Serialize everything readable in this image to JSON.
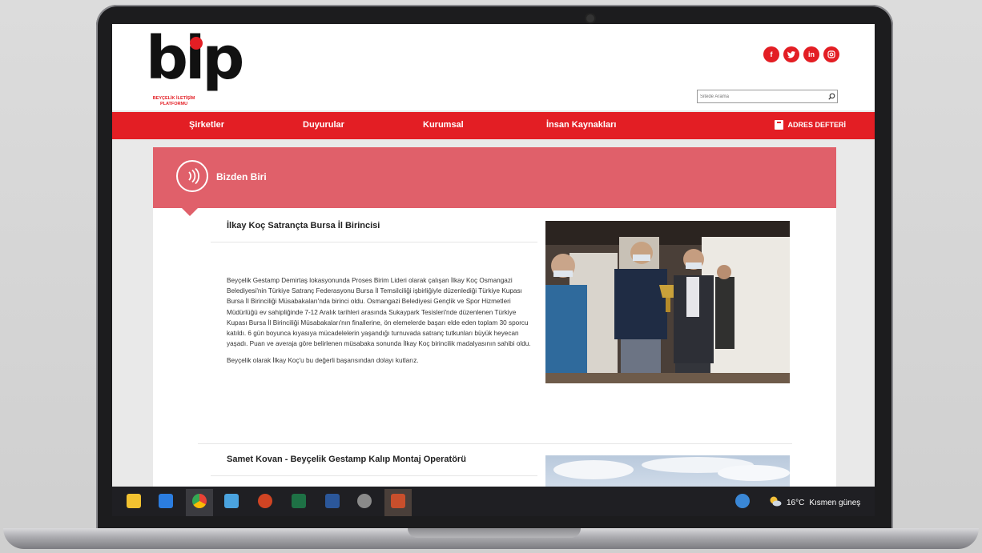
{
  "site": {
    "logo": {
      "wordmark": "bip",
      "subtitle_line1": "BEYÇELİK İLETİŞİM",
      "subtitle_line2": "PLATFORMU"
    },
    "socials": [
      {
        "icon": "facebook-icon",
        "glyph": "f"
      },
      {
        "icon": "twitter-icon",
        "glyph": "t"
      },
      {
        "icon": "linkedin-icon",
        "glyph": "in"
      },
      {
        "icon": "instagram-icon",
        "glyph": "◎"
      }
    ],
    "search": {
      "placeholder": "Sitede Arama"
    },
    "nav": {
      "items": [
        "Şirketler",
        "Duyurular",
        "Kurumsal",
        "İnsan Kaynakları"
      ],
      "adres_defteri": "ADRES DEFTERİ"
    },
    "section": {
      "title": "Bizden Biri"
    },
    "articles": [
      {
        "title": "İlkay Koç Satrançta Bursa İl Birincisi",
        "paragraphs": [
          "Beyçelik Gestamp Demirtaş lokasyonunda Proses Birim Lideri olarak çalışan İlkay Koç Osmangazi Belediyesi'nin Türkiye Satranç Federasyonu Bursa İl Temsilciliği işbirliğiyle düzenlediği Türkiye Kupası Bursa İl Birinciliği Müsabakaları'nda birinci oldu. Osmangazi Belediyesi Gençlik ve Spor Hizmetleri Müdürlüğü ev sahipliğinde 7-12 Aralık tarihleri arasında Sukaypark Tesisleri'nde düzenlenen Türkiye Kupası Bursa İl Birinciliği Müsabakaları'nın finallerine, ön elemelerde başarı elde eden toplam 30 sporcu katıldı. 6 gün boyunca kıyasıya mücadelelerin yaşandığı turnuvada satranç tutkunları büyük heyecan yaşadı. Puan ve averaja göre belirlenen müsabaka sonunda İlkay Koç birincilik madalyasının sahibi oldu.",
          "Beyçelik olarak İlkay Koç'u bu değerli başarısından dolayı kutlarız."
        ]
      },
      {
        "title": "Samet Kovan - Beyçelik Gestamp Kalıp Montaj Operatörü"
      }
    ]
  },
  "taskbar": {
    "apps": [
      {
        "icon": "file-explorer-icon",
        "color": "#f2c230"
      },
      {
        "icon": "windows-store-icon",
        "color": "#2b7de0"
      },
      {
        "icon": "chrome-icon",
        "color": "#e94235"
      },
      {
        "icon": "paint-icon",
        "color": "#4aa3df"
      },
      {
        "icon": "powerpoint-icon",
        "color": "#d04423"
      },
      {
        "icon": "excel-icon",
        "color": "#1e7145"
      },
      {
        "icon": "word-icon",
        "color": "#2b579a"
      },
      {
        "icon": "settings-icon",
        "color": "#8a8a8a"
      },
      {
        "icon": "outlook-icon",
        "color": "#c94f2c"
      }
    ],
    "weather": {
      "temperature": "16°C",
      "condition": "Kısmen güneş"
    }
  },
  "colors": {
    "brand_red": "#e31e24",
    "section_pink": "#e0606a"
  }
}
